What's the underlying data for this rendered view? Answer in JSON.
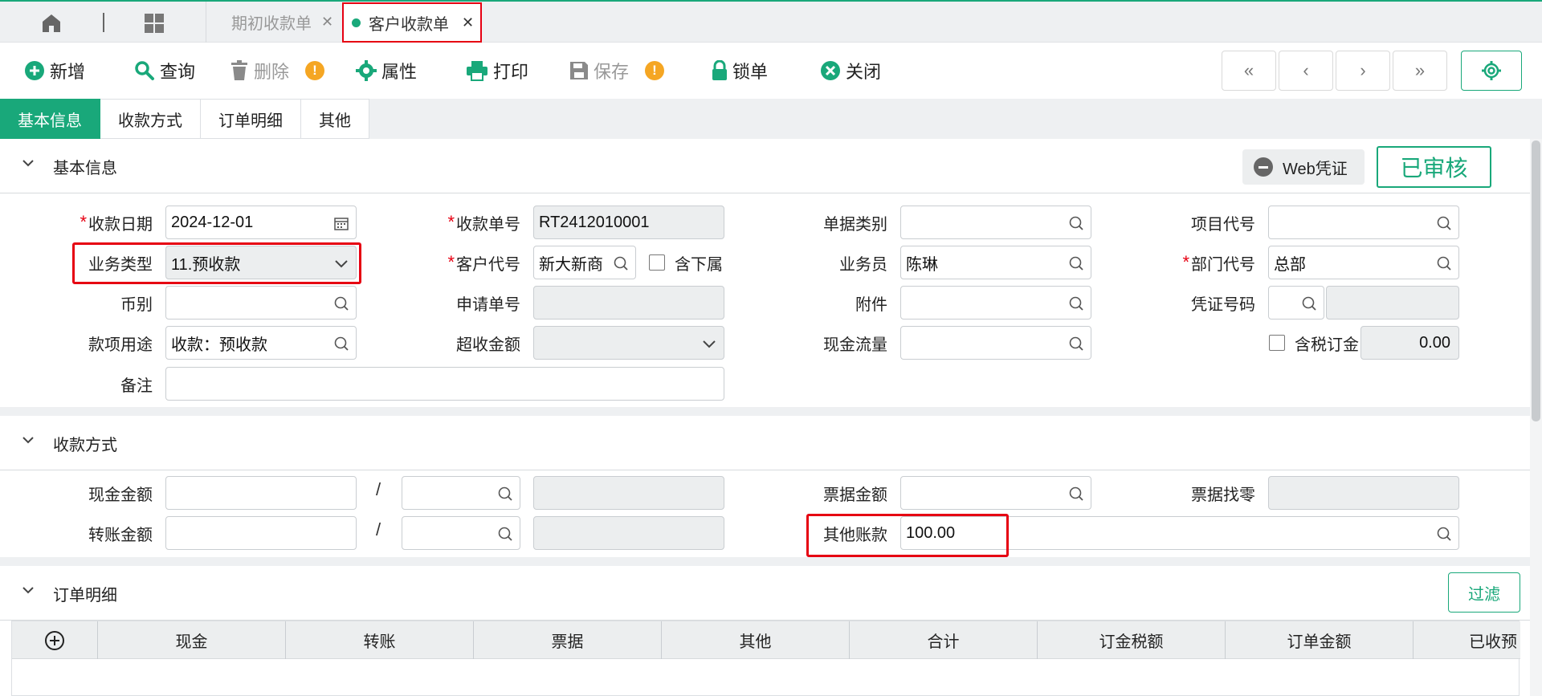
{
  "tabs": [
    {
      "label": "期初收款单",
      "active": false
    },
    {
      "label": "客户收款单",
      "active": true
    }
  ],
  "toolbar": {
    "new": "新增",
    "query": "查询",
    "delete": "删除",
    "property": "属性",
    "print": "打印",
    "save": "保存",
    "lock": "锁单",
    "close": "关闭",
    "nav_first": "«",
    "nav_prev": "‹",
    "nav_next": "›",
    "nav_last": "»"
  },
  "section_tabs": [
    "基本信息",
    "收款方式",
    "订单明细",
    "其他"
  ],
  "basic": {
    "title": "基本信息",
    "web_voucher": "Web凭证",
    "status_stamp": "已审核",
    "receipt_date_label": "收款日期",
    "receipt_date": "2024-12-01",
    "receipt_no_label": "收款单号",
    "receipt_no": "RT2412010001",
    "doc_type_label": "单据类别",
    "doc_type": "",
    "project_code_label": "项目代号",
    "project_code": "",
    "biz_type_label": "业务类型",
    "biz_type": "11.预收款",
    "customer_code_label": "客户代号",
    "customer_code": "新大新商",
    "include_sub_label": "含下属",
    "salesperson_label": "业务员",
    "salesperson": "陈琳",
    "dept_code_label": "部门代号",
    "dept_code": "总部",
    "currency_label": "币别",
    "currency": "",
    "apply_no_label": "申请单号",
    "apply_no": "",
    "attachment_label": "附件",
    "attachment": "",
    "voucher_no_label": "凭证号码",
    "voucher_no": "",
    "purpose_label": "款项用途",
    "purpose": "收款：预收款",
    "over_amount_label": "超收金额",
    "over_amount": "",
    "cash_flow_label": "现金流量",
    "cash_flow": "",
    "tax_order_label": "含税订金",
    "tax_order": "0.00",
    "remark_label": "备注",
    "remark": ""
  },
  "payment": {
    "title": "收款方式",
    "cash_label": "现金金额",
    "cash": "",
    "transfer_label": "转账金额",
    "transfer": "",
    "bill_label": "票据金额",
    "bill": "",
    "bill_change_label": "票据找零",
    "bill_change": "",
    "other_label": "其他账款",
    "other": "100.00",
    "slash": "/"
  },
  "order": {
    "title": "订单明细",
    "filter": "过滤",
    "columns": [
      "现金",
      "转账",
      "票据",
      "其他",
      "合计",
      "订金税额",
      "订单金额",
      "已收预"
    ]
  }
}
